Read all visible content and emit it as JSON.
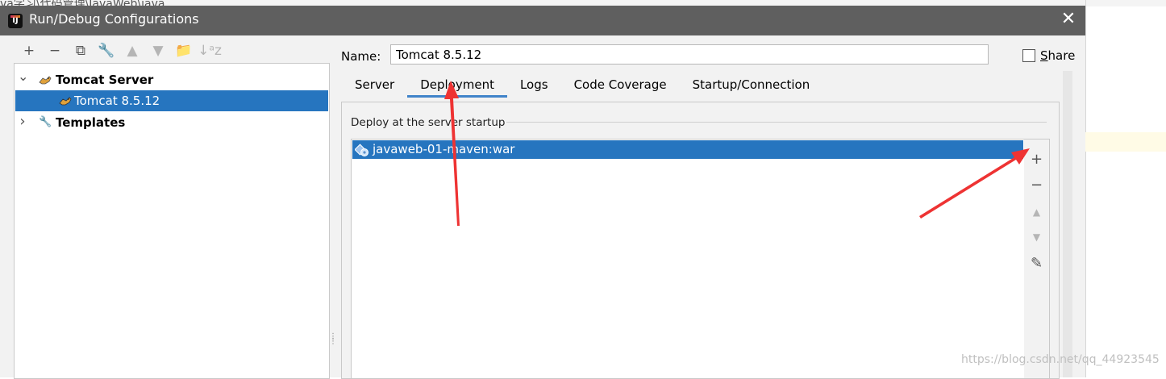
{
  "background": {
    "path_fragment": "va学习\\代码管理\\JavaWeb\\java"
  },
  "dialog": {
    "title": "Run/Debug Configurations",
    "app_icon_text": "IJ"
  },
  "toolbar": {
    "items": [
      {
        "icon": "plus-icon",
        "glyph": "+",
        "enabled": true
      },
      {
        "icon": "minus-icon",
        "glyph": "−",
        "enabled": true
      },
      {
        "icon": "copy-icon",
        "glyph": "⧉",
        "enabled": true
      },
      {
        "icon": "wrench-icon",
        "glyph": "🔧",
        "enabled": true
      },
      {
        "icon": "move-up-icon",
        "glyph": "▲",
        "enabled": false
      },
      {
        "icon": "move-down-icon",
        "glyph": "▼",
        "enabled": false
      },
      {
        "icon": "folder-add-icon",
        "glyph": "📁",
        "enabled": true
      },
      {
        "icon": "sort-alpha-icon",
        "glyph": "↓ᵃz",
        "enabled": false
      }
    ]
  },
  "tree": {
    "items": [
      {
        "label": "Tomcat Server",
        "level": 0,
        "expanded": true,
        "bold": true,
        "selected": false,
        "icon": "tomcat-icon"
      },
      {
        "label": "Tomcat 8.5.12",
        "level": 1,
        "expanded": false,
        "bold": false,
        "selected": true,
        "icon": "tomcat-icon"
      },
      {
        "label": "Templates",
        "level": 0,
        "expanded": false,
        "bold": true,
        "selected": false,
        "icon": "wrench-icon"
      }
    ]
  },
  "config": {
    "name_label": "Name:",
    "name_value": "Tomcat 8.5.12",
    "share_label": "Share",
    "share_checked": false
  },
  "tabs": [
    {
      "label": "Server",
      "active": false
    },
    {
      "label": "Deployment",
      "active": true
    },
    {
      "label": "Logs",
      "active": false
    },
    {
      "label": "Code Coverage",
      "active": false
    },
    {
      "label": "Startup/Connection",
      "active": false
    }
  ],
  "deployment": {
    "group_title": "Deploy at the server startup",
    "artifacts": [
      {
        "label": "javaweb-01-maven:war",
        "selected": true,
        "icon": "artifact-icon"
      }
    ],
    "side_actions": [
      {
        "icon": "add-icon",
        "glyph": "+",
        "enabled": true
      },
      {
        "icon": "remove-icon",
        "glyph": "−",
        "enabled": true
      },
      {
        "icon": "move-up-icon",
        "glyph": "▲",
        "enabled": false
      },
      {
        "icon": "move-down-icon",
        "glyph": "▼",
        "enabled": false
      },
      {
        "icon": "edit-icon",
        "glyph": "✎",
        "enabled": true
      }
    ]
  },
  "watermark": "https://blog.csdn.net/qq_44923545",
  "colors": {
    "titlebar": "#5f5f5f",
    "selection": "#2675bf",
    "tab_underline": "#4083c9",
    "annotation_arrow": "#ee3333"
  }
}
